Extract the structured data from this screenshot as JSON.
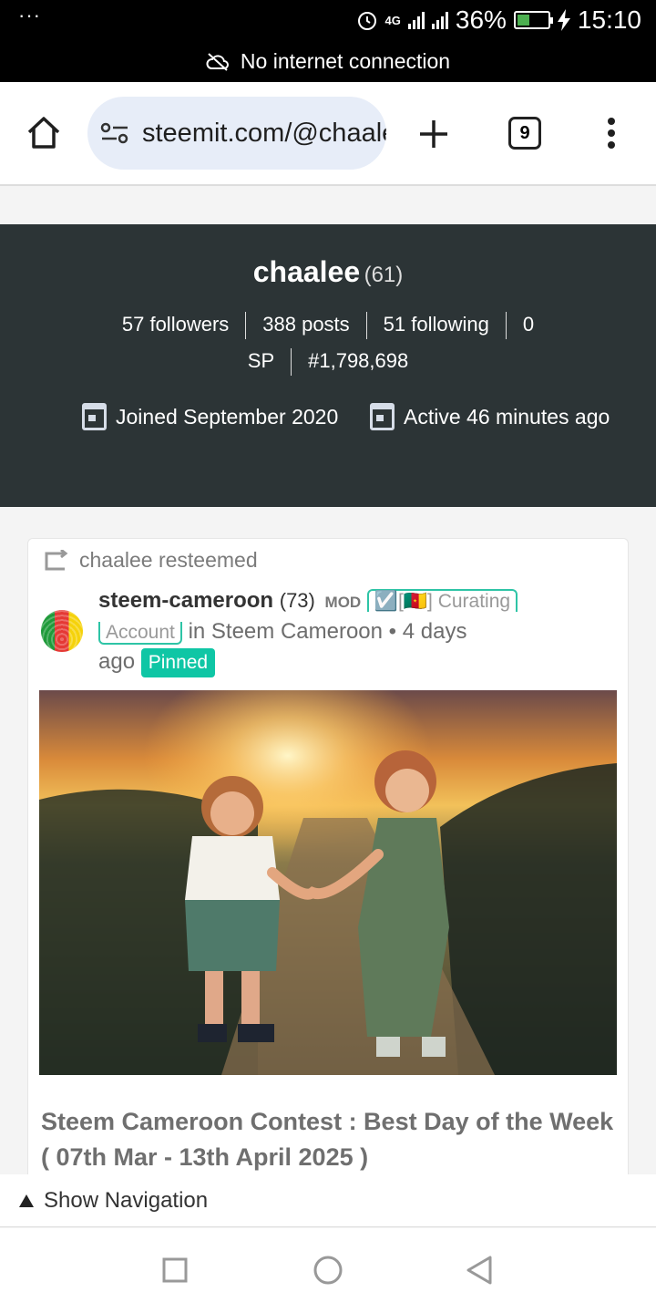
{
  "status_bar": {
    "dots": "···",
    "network_type": "4G",
    "battery": "36%",
    "battery_level": 0.36,
    "time": "15:10",
    "notice": "No internet connection"
  },
  "browser": {
    "url": "steemit.com/@chaalee",
    "tab_count": "9"
  },
  "profile": {
    "name": "chaalee",
    "reputation": "(61)",
    "followers": "57 followers",
    "posts": "388 posts",
    "following": "51 following",
    "sp_value": "0",
    "sp_label": "SP",
    "rank": "#1,798,698",
    "joined": "Joined September 2020",
    "active": "Active 46 minutes ago"
  },
  "post": {
    "resteemed_by": "chaalee resteemed",
    "author": "steem-cameroon",
    "author_rep": "(73)",
    "mod": "MOD",
    "badge_line1": "☑️[🇨🇲] Curating",
    "badge_line2": "Account",
    "community": "in Steem Cameroon",
    "time_part1": "• 4 days",
    "time_part2": "ago",
    "pinned": "Pinned",
    "title": "Steem Cameroon Contest : Best Day of the Week ( 07th Mar - 13th April 2025 )"
  },
  "bottom": {
    "show_navigation": "Show Navigation"
  }
}
